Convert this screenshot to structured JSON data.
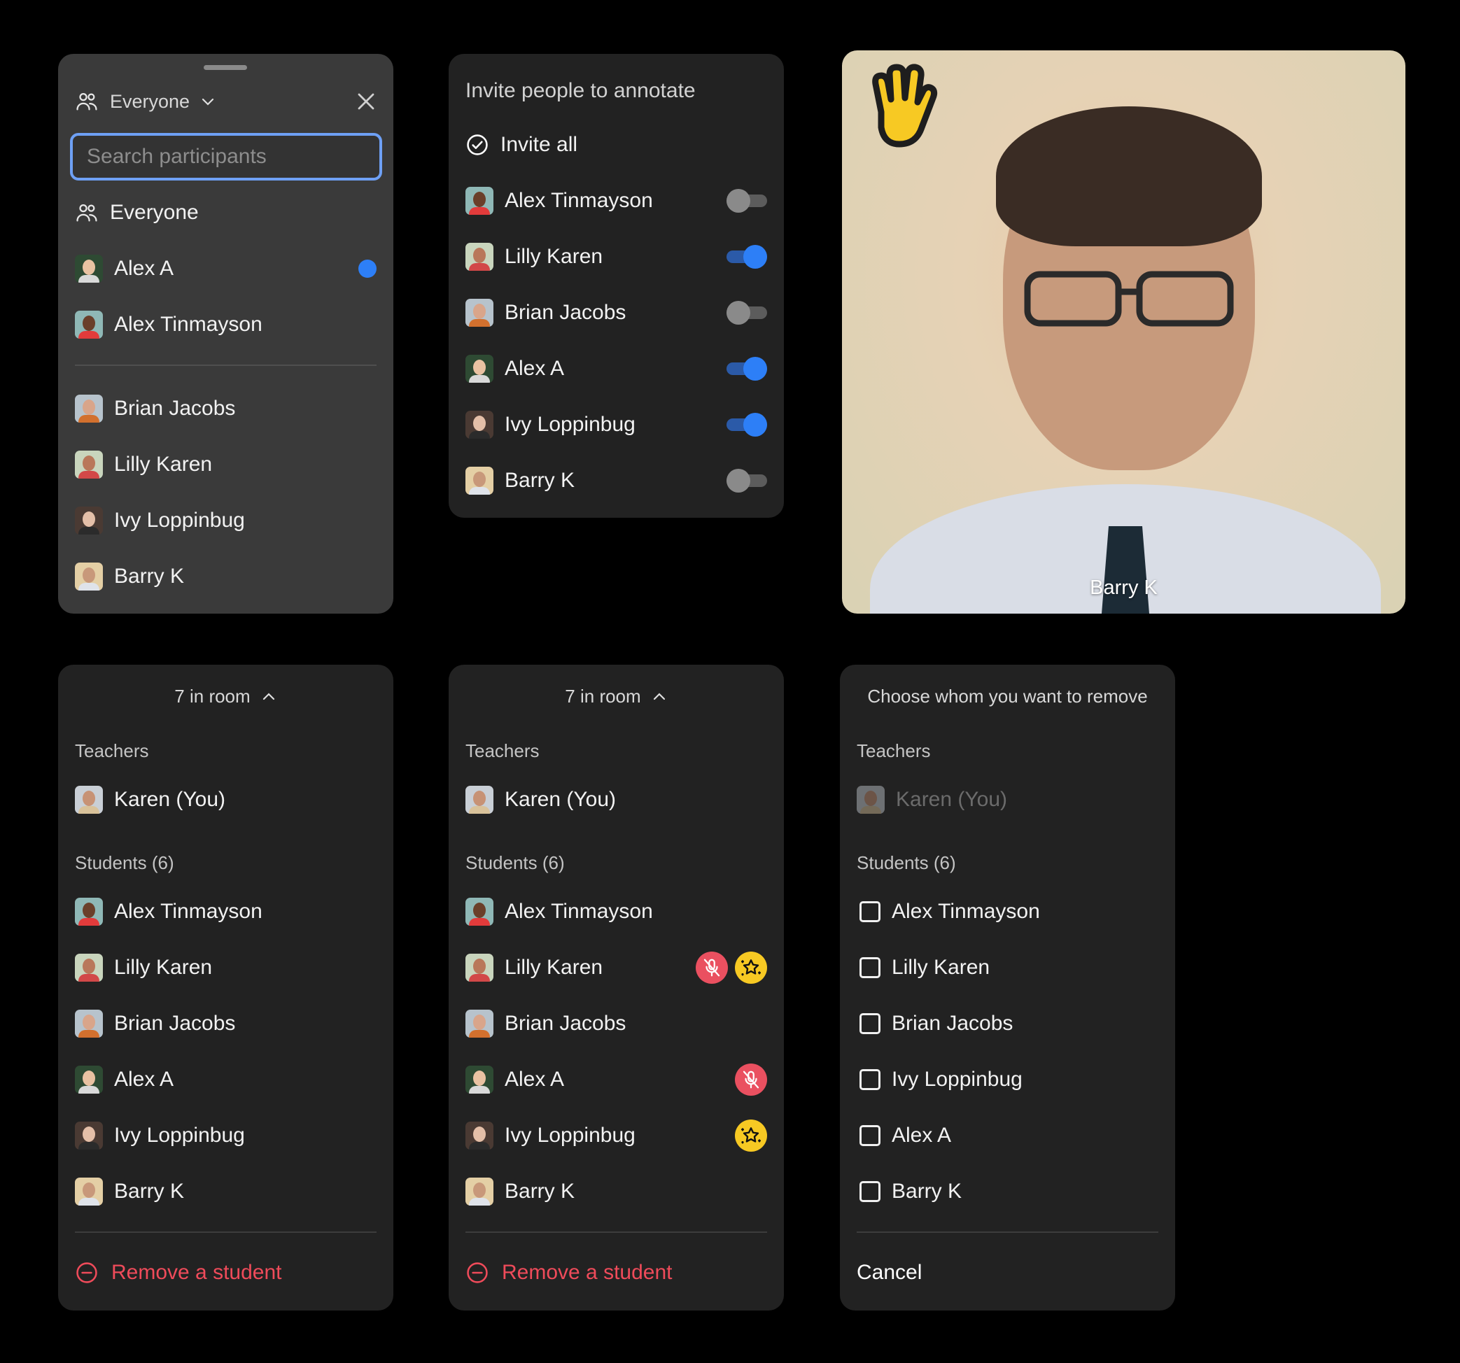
{
  "colors": {
    "accent_blue": "#2d7ff7",
    "danger_red": "#ef4b5a",
    "star_yellow": "#f7c923",
    "panel_bg": "#222222",
    "panel_light_bg": "#3a3a3a"
  },
  "participants_picker": {
    "header_label": "Everyone",
    "header_icon": "people-icon",
    "search_placeholder": "Search participants",
    "search_value": "",
    "top_items": [
      {
        "label": "Everyone",
        "type": "group",
        "selected": false
      },
      {
        "label": "Alex A",
        "type": "person",
        "selected": true
      },
      {
        "label": "Alex Tinmayson",
        "type": "person",
        "selected": false
      }
    ],
    "items": [
      {
        "label": "Brian Jacobs"
      },
      {
        "label": "Lilly Karen"
      },
      {
        "label": "Ivy Loppinbug"
      },
      {
        "label": "Barry K"
      }
    ]
  },
  "annotate_invite": {
    "title": "Invite people to annotate",
    "invite_all_label": "Invite all",
    "people": [
      {
        "name": "Alex Tinmayson",
        "enabled": false
      },
      {
        "name": "Lilly Karen",
        "enabled": true
      },
      {
        "name": "Brian Jacobs",
        "enabled": false
      },
      {
        "name": "Alex A",
        "enabled": true
      },
      {
        "name": "Ivy Loppinbug",
        "enabled": true
      },
      {
        "name": "Barry K",
        "enabled": false
      }
    ]
  },
  "video_tile": {
    "name": "Barry K",
    "hand_raised": true
  },
  "room_list": {
    "header": "7 in room",
    "teachers_label": "Teachers",
    "teacher": "Karen (You)",
    "students_label": "Students (6)",
    "students": [
      "Alex Tinmayson",
      "Lilly Karen",
      "Brian Jacobs",
      "Alex A",
      "Ivy Loppinbug",
      "Barry K"
    ],
    "remove_label": "Remove a student"
  },
  "room_list_status": {
    "header": "7 in room",
    "teachers_label": "Teachers",
    "teacher": "Karen (You)",
    "students_label": "Students (6)",
    "students": [
      {
        "name": "Alex Tinmayson",
        "muted": false,
        "starred": false
      },
      {
        "name": "Lilly Karen",
        "muted": true,
        "starred": true
      },
      {
        "name": "Brian Jacobs",
        "muted": false,
        "starred": false
      },
      {
        "name": "Alex A",
        "muted": true,
        "starred": false
      },
      {
        "name": "Ivy Loppinbug",
        "muted": false,
        "starred": true
      },
      {
        "name": "Barry K",
        "muted": false,
        "starred": false
      }
    ],
    "remove_label": "Remove a student"
  },
  "remove_chooser": {
    "title": "Choose whom you want to remove",
    "teachers_label": "Teachers",
    "teacher": "Karen (You)",
    "students_label": "Students (6)",
    "students": [
      {
        "name": "Alex Tinmayson",
        "checked": false
      },
      {
        "name": "Lilly Karen",
        "checked": false
      },
      {
        "name": "Brian Jacobs",
        "checked": false
      },
      {
        "name": "Ivy Loppinbug",
        "checked": false
      },
      {
        "name": "Alex A",
        "checked": false
      },
      {
        "name": "Barry K",
        "checked": false
      }
    ],
    "cancel_label": "Cancel"
  }
}
